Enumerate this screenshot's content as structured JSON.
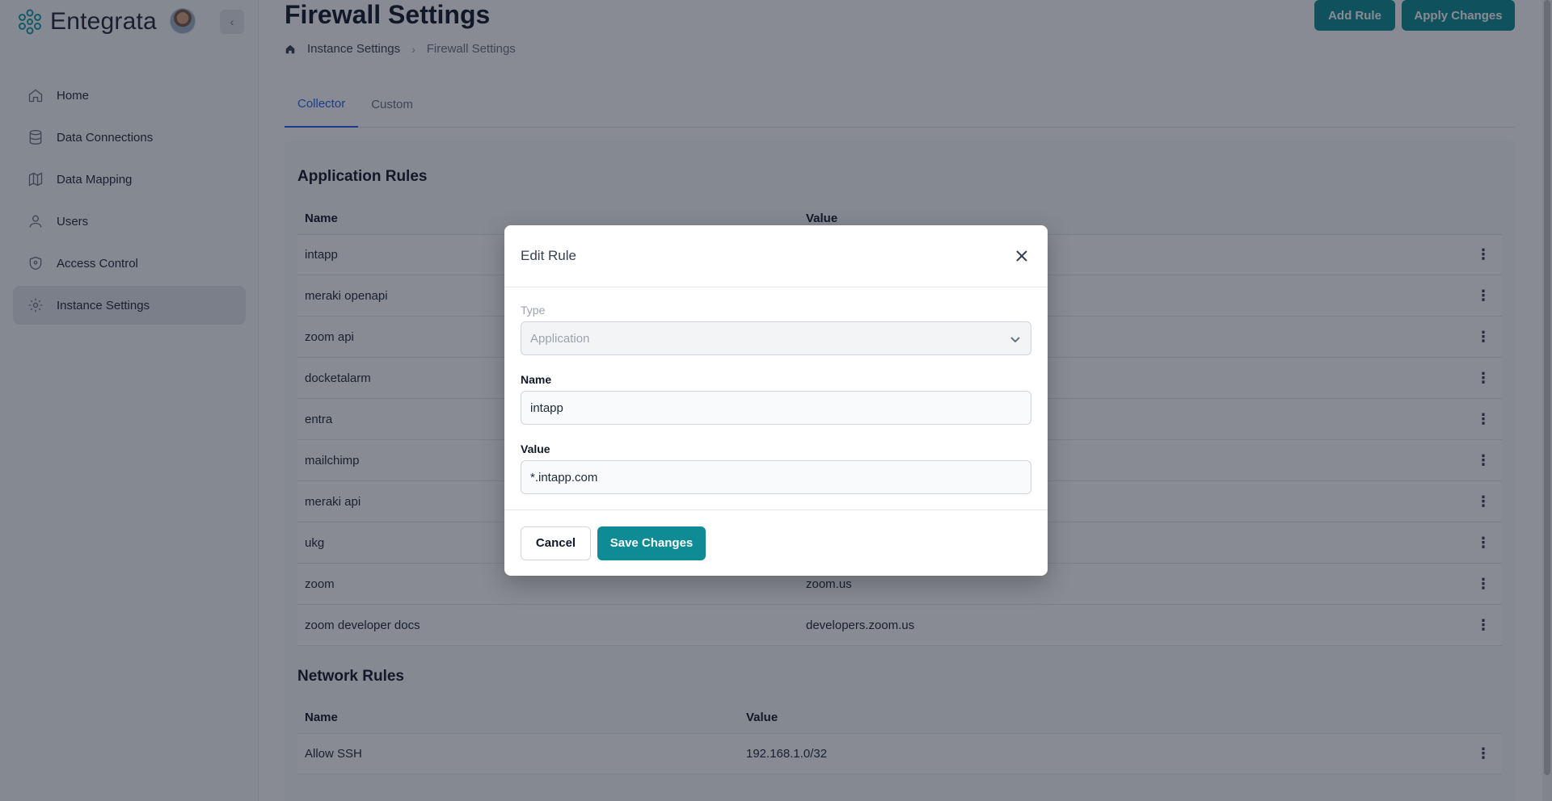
{
  "brand": {
    "name": "Entegrata"
  },
  "colors": {
    "accent": "#0e8b94",
    "tab_active": "#2563eb"
  },
  "sidebar": {
    "collapse_glyph": "‹",
    "items": [
      {
        "label": "Home",
        "icon": "home-icon"
      },
      {
        "label": "Data Connections",
        "icon": "database-icon"
      },
      {
        "label": "Data Mapping",
        "icon": "map-icon"
      },
      {
        "label": "Users",
        "icon": "user-icon"
      },
      {
        "label": "Access Control",
        "icon": "shield-icon"
      },
      {
        "label": "Instance Settings",
        "icon": "gear-icon",
        "active": true
      }
    ]
  },
  "header": {
    "title": "Firewall Settings",
    "breadcrumb": [
      "Instance Settings",
      "Firewall Settings"
    ],
    "add_rule_label": "Add Rule",
    "apply_changes_label": "Apply Changes"
  },
  "tabs": [
    {
      "label": "Collector",
      "active": true
    },
    {
      "label": "Custom",
      "active": false
    }
  ],
  "application_rules": {
    "title": "Application Rules",
    "columns": [
      "Name",
      "Value"
    ],
    "rows": [
      {
        "name": "intapp",
        "value": ""
      },
      {
        "name": "meraki openapi",
        "value": ""
      },
      {
        "name": "zoom api",
        "value": ""
      },
      {
        "name": "docketalarm",
        "value": ""
      },
      {
        "name": "entra",
        "value": ""
      },
      {
        "name": "mailchimp",
        "value": ""
      },
      {
        "name": "meraki api",
        "value": ""
      },
      {
        "name": "ukg",
        "value": ""
      },
      {
        "name": "zoom",
        "value": "zoom.us"
      },
      {
        "name": "zoom developer docs",
        "value": "developers.zoom.us"
      }
    ]
  },
  "network_rules": {
    "title": "Network Rules",
    "columns": [
      "Name",
      "Value"
    ],
    "rows": [
      {
        "name": "Allow SSH",
        "value": "192.168.1.0/32"
      }
    ]
  },
  "modal": {
    "title": "Edit Rule",
    "type_label": "Type",
    "type_value": "Application",
    "name_label": "Name",
    "name_value": "intapp",
    "value_label": "Value",
    "value_value": "*.intapp.com",
    "cancel_label": "Cancel",
    "save_label": "Save Changes"
  }
}
